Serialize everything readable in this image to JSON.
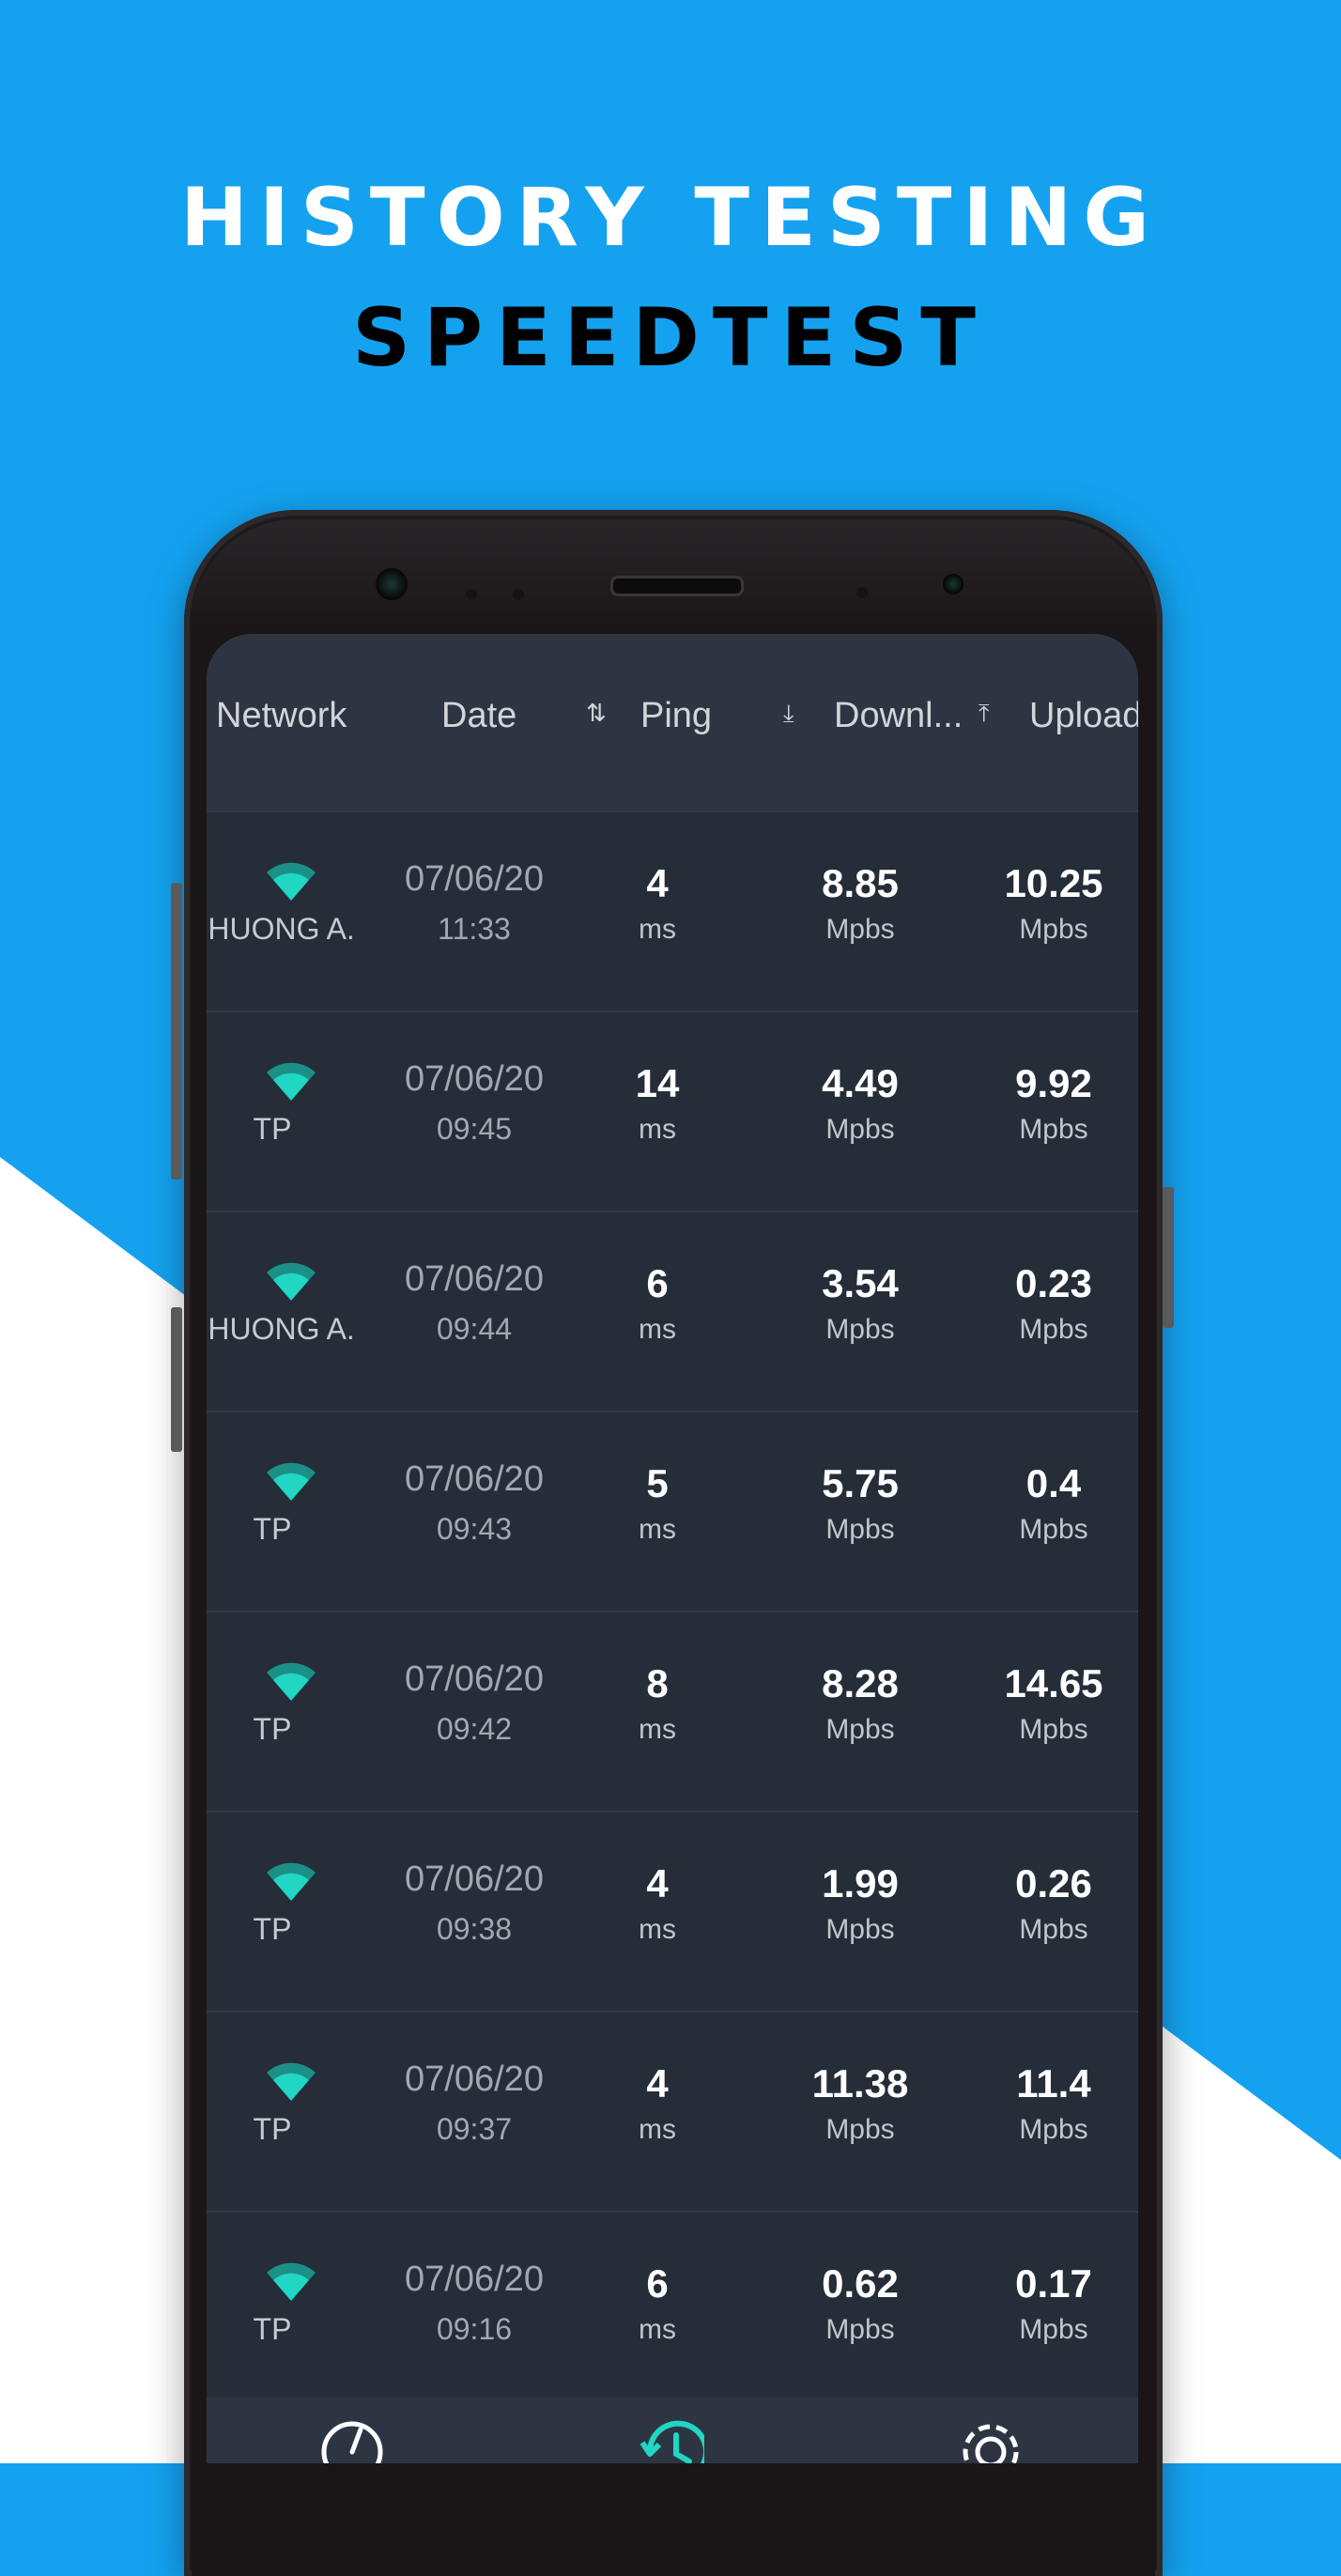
{
  "headline": {
    "line1": "HISTORY TESTING",
    "line2": "SPEEDTEST"
  },
  "colors": {
    "sky": "#14a2f0",
    "wifi": "#1fd7c4",
    "screen": "#252d38",
    "header": "#2e3542"
  },
  "table": {
    "headers": {
      "network": "Network",
      "date": "Date",
      "ping": "Ping",
      "download": "Downl...",
      "upload": "Upload"
    },
    "rows": [
      {
        "network": "PHUONG A...",
        "date": "07/06/20",
        "time": "11:33",
        "ping": "4",
        "ping_unit": "ms",
        "download": "8.85",
        "download_unit": "Mpbs",
        "upload": "10.25",
        "upload_unit": "Mpbs"
      },
      {
        "network": "TP",
        "date": "07/06/20",
        "time": "09:45",
        "ping": "14",
        "ping_unit": "ms",
        "download": "4.49",
        "download_unit": "Mpbs",
        "upload": "9.92",
        "upload_unit": "Mpbs"
      },
      {
        "network": "PHUONG A...",
        "date": "07/06/20",
        "time": "09:44",
        "ping": "6",
        "ping_unit": "ms",
        "download": "3.54",
        "download_unit": "Mpbs",
        "upload": "0.23",
        "upload_unit": "Mpbs"
      },
      {
        "network": "TP",
        "date": "07/06/20",
        "time": "09:43",
        "ping": "5",
        "ping_unit": "ms",
        "download": "5.75",
        "download_unit": "Mpbs",
        "upload": "0.4",
        "upload_unit": "Mpbs"
      },
      {
        "network": "TP",
        "date": "07/06/20",
        "time": "09:42",
        "ping": "8",
        "ping_unit": "ms",
        "download": "8.28",
        "download_unit": "Mpbs",
        "upload": "14.65",
        "upload_unit": "Mpbs"
      },
      {
        "network": "TP",
        "date": "07/06/20",
        "time": "09:38",
        "ping": "4",
        "ping_unit": "ms",
        "download": "1.99",
        "download_unit": "Mpbs",
        "upload": "0.26",
        "upload_unit": "Mpbs"
      },
      {
        "network": "TP",
        "date": "07/06/20",
        "time": "09:37",
        "ping": "4",
        "ping_unit": "ms",
        "download": "11.38",
        "download_unit": "Mpbs",
        "upload": "11.4",
        "upload_unit": "Mpbs"
      },
      {
        "network": "TP",
        "date": "07/06/20",
        "time": "09:16",
        "ping": "6",
        "ping_unit": "ms",
        "download": "0.62",
        "download_unit": "Mpbs",
        "upload": "0.17",
        "upload_unit": "Mpbs"
      }
    ]
  },
  "nav": {
    "items": [
      "speedometer-icon",
      "history-icon",
      "settings-icon"
    ],
    "active": "history-icon"
  }
}
